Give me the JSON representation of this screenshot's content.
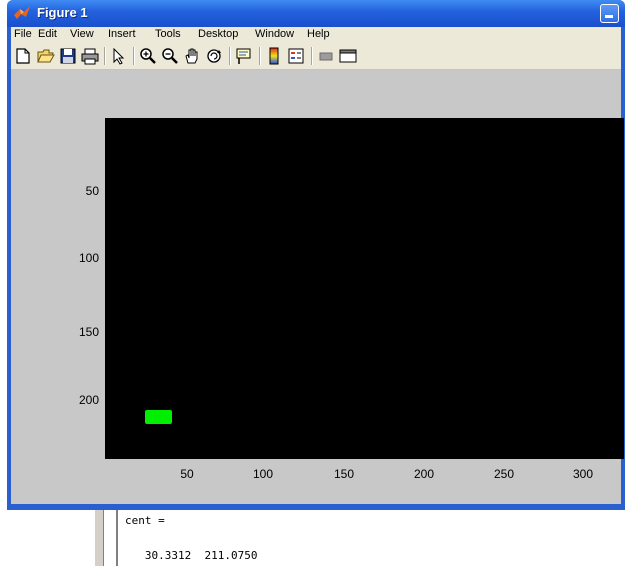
{
  "window": {
    "title": "Figure 1",
    "icon": "matlab-icon",
    "minimize_icon": "minimize-icon"
  },
  "menu": [
    "File",
    "Edit",
    "View",
    "Insert",
    "Tools",
    "Desktop",
    "Window",
    "Help"
  ],
  "toolbar": {
    "icons": [
      "new-figure-icon",
      "open-file-icon",
      "save-icon",
      "print-icon",
      "edit-plot-arrow-icon",
      "zoom-in-icon",
      "zoom-out-icon",
      "pan-hand-icon",
      "rotate-3d-icon",
      "data-cursor-icon",
      "colorbar-icon",
      "legend-icon",
      "hide-plot-tools-icon",
      "show-plot-tools-icon"
    ]
  },
  "axes": {
    "background": "#000000",
    "y_ticks": [
      "50",
      "100",
      "150",
      "200"
    ],
    "x_ticks": [
      "50",
      "100",
      "150",
      "200",
      "250",
      "300"
    ],
    "blob_color": "#00ee00"
  },
  "command_window": {
    "line1": "cent =",
    "line2": "   30.3312  211.0750"
  }
}
